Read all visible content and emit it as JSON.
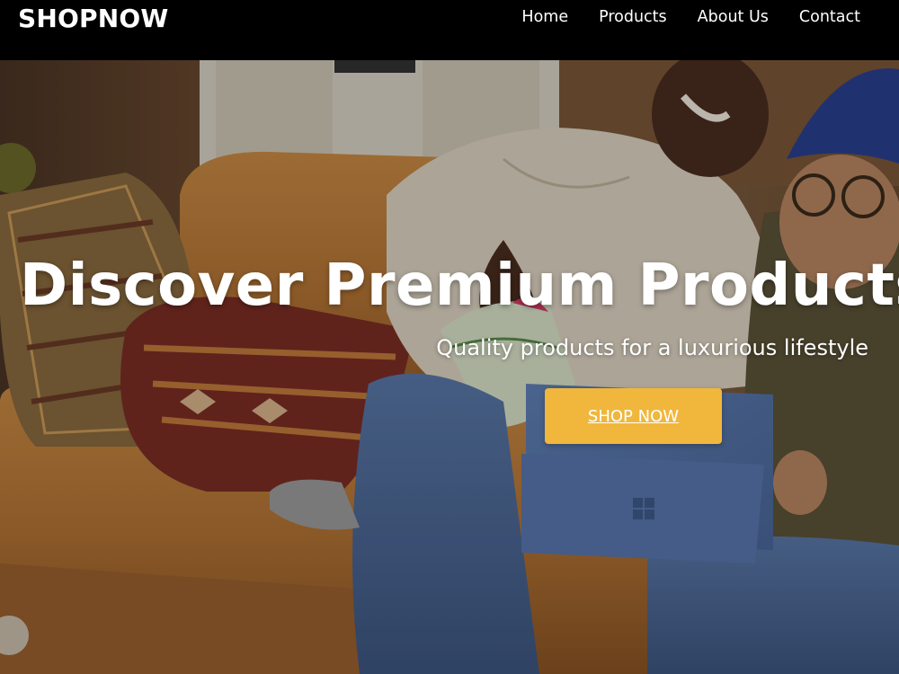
{
  "brand": {
    "name": "SHOPNOW"
  },
  "nav": {
    "items": [
      {
        "label": "Home"
      },
      {
        "label": "Products"
      },
      {
        "label": "About Us"
      },
      {
        "label": "Contact"
      }
    ]
  },
  "hero": {
    "title": "Discover Premium Products o",
    "subtitle": "Quality products for a luxurious lifestyle",
    "cta_label": "SHOP NOW"
  },
  "colors": {
    "navbar_bg": "#000000",
    "cta_bg": "#f0b73c",
    "text": "#ffffff"
  }
}
